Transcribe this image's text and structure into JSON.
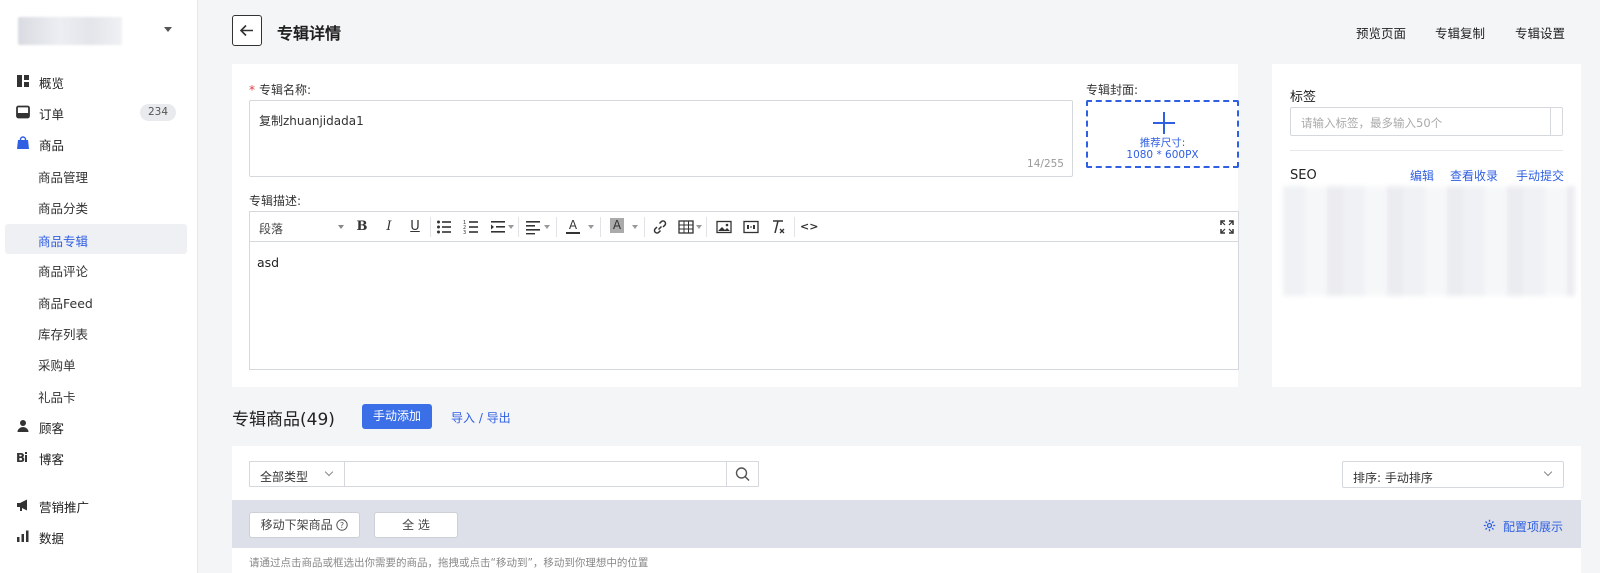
{
  "sidebar": {
    "items": [
      {
        "label": "概览"
      },
      {
        "label": "订单",
        "badge": "234"
      },
      {
        "label": "商品"
      },
      {
        "label": "商品管理"
      },
      {
        "label": "商品分类"
      },
      {
        "label": "商品专辑"
      },
      {
        "label": "商品评论"
      },
      {
        "label": "商品Feed"
      },
      {
        "label": "库存列表"
      },
      {
        "label": "采购单"
      },
      {
        "label": "礼品卡"
      },
      {
        "label": "顾客"
      },
      {
        "label": "博客"
      },
      {
        "label": "营销推广"
      },
      {
        "label": "数据"
      }
    ]
  },
  "header": {
    "title": "专辑详情",
    "links": [
      "预览页面",
      "专辑复制",
      "专辑设置"
    ]
  },
  "form": {
    "name_label": "专辑名称:",
    "name_value": "复制zhuanjidada1",
    "name_count": "14/255",
    "cover_label": "专辑封面:",
    "cover_hint": "推荐尺寸:",
    "cover_size": "1080 * 600PX",
    "desc_label": "专辑描述:",
    "paragraph": "段落",
    "desc_content": "asd"
  },
  "right": {
    "tag_title": "标签",
    "tag_placeholder": "请输入标签，最多输入50个",
    "seo_title": "SEO",
    "seo_links": [
      "编辑",
      "查看收录",
      "手动提交"
    ]
  },
  "products": {
    "title": "专辑商品(49)",
    "add_button": "手动添加",
    "import_export": "导入 / 导出",
    "type_filter": "全部类型",
    "sort": "排序: 手动排序",
    "move_off_button": "移动下架商品",
    "select_all_button": "全 选",
    "config_link": "配置项展示",
    "hint": "请通过点击商品或框选出你需要的商品，拖拽或点击“移动到”，移动到你理想中的位置"
  },
  "colors": {
    "accent": "#3b6fe8",
    "link": "#2f5fe3",
    "required": "#e23c3c"
  }
}
